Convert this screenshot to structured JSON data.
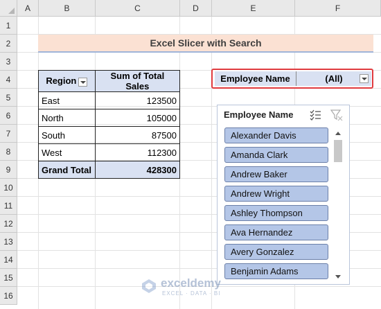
{
  "sheet": {
    "columns": [
      "A",
      "B",
      "C",
      "D",
      "E",
      "F"
    ],
    "rows": [
      "1",
      "2",
      "3",
      "4",
      "5",
      "6",
      "7",
      "8",
      "9",
      "10",
      "11",
      "12",
      "13",
      "14",
      "15",
      "16"
    ]
  },
  "title": "Excel Slicer with Search",
  "pivot": {
    "header_region": "Region",
    "header_sales": "Sum of Total Sales",
    "rows": [
      {
        "region": "East",
        "sales": "123500"
      },
      {
        "region": "North",
        "sales": "105000"
      },
      {
        "region": "South",
        "sales": "87500"
      },
      {
        "region": "West",
        "sales": "112300"
      }
    ],
    "total_label": "Grand Total",
    "total_value": "428300"
  },
  "filter": {
    "label": "Employee Name",
    "value": "(All)"
  },
  "slicer": {
    "title": "Employee Name",
    "items": [
      "Alexander Davis",
      "Amanda Clark",
      "Andrew Baker",
      "Andrew Wright",
      "Ashley Thompson",
      "Ava Hernandez",
      "Avery Gonzalez",
      "Benjamin Adams"
    ]
  },
  "watermark": {
    "brand": "exceldemy",
    "tagline": "EXCEL · DATA · BI"
  },
  "colors": {
    "header_fill": "#d9e1f2",
    "slicer_item": "#b4c6e7",
    "title_band": "#fbe1d3",
    "highlight_border": "#e03a3e"
  }
}
